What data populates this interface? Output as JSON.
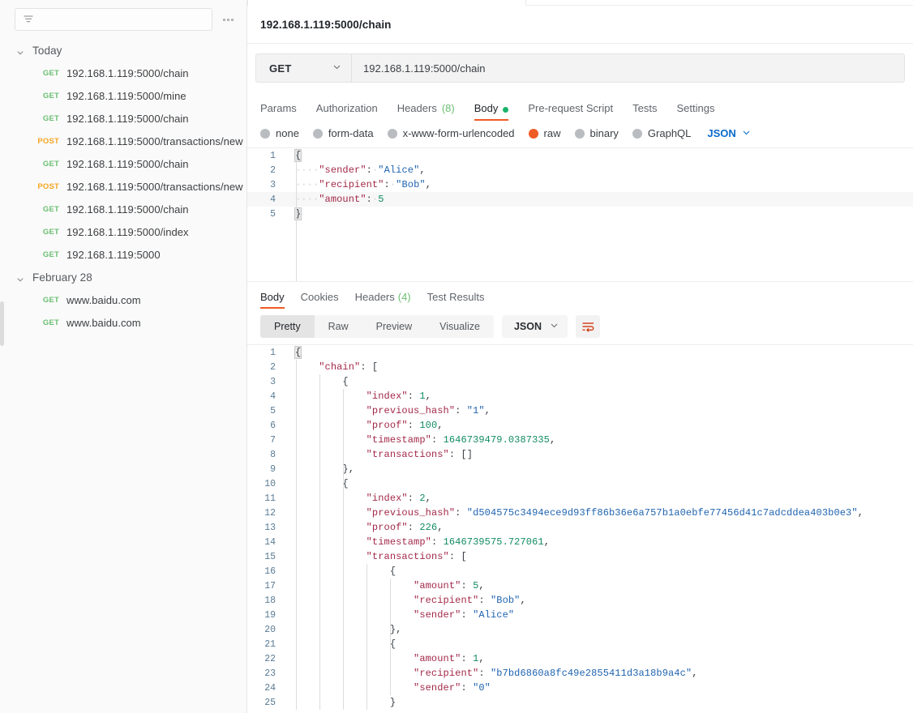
{
  "sidebar": {
    "filter_placeholder": "",
    "filter_icon": "filter-icon",
    "more_icon": "more-options-icon",
    "groups": [
      {
        "label": "Today",
        "items": [
          {
            "method": "GET",
            "url": "192.168.1.119:5000/chain"
          },
          {
            "method": "GET",
            "url": "192.168.1.119:5000/mine"
          },
          {
            "method": "GET",
            "url": "192.168.1.119:5000/chain"
          },
          {
            "method": "POST",
            "url": "192.168.1.119:5000/transactions/new"
          },
          {
            "method": "GET",
            "url": "192.168.1.119:5000/chain"
          },
          {
            "method": "POST",
            "url": "192.168.1.119:5000/transactions/new"
          },
          {
            "method": "GET",
            "url": "192.168.1.119:5000/chain"
          },
          {
            "method": "GET",
            "url": "192.168.1.119:5000/index"
          },
          {
            "method": "GET",
            "url": "192.168.1.119:5000"
          }
        ]
      },
      {
        "label": "February 28",
        "items": [
          {
            "method": "GET",
            "url": "www.baidu.com"
          },
          {
            "method": "GET",
            "url": "www.baidu.com"
          }
        ]
      }
    ]
  },
  "request": {
    "title": "192.168.1.119:5000/chain",
    "method": "GET",
    "url": "192.168.1.119:5000/chain",
    "tabs": [
      {
        "label": "Params",
        "count": "",
        "active": false,
        "dot": false
      },
      {
        "label": "Authorization",
        "count": "",
        "active": false,
        "dot": false
      },
      {
        "label": "Headers",
        "count": "(8)",
        "active": false,
        "dot": false
      },
      {
        "label": "Body",
        "count": "",
        "active": true,
        "dot": true
      },
      {
        "label": "Pre-request Script",
        "count": "",
        "active": false,
        "dot": false
      },
      {
        "label": "Tests",
        "count": "",
        "active": false,
        "dot": false
      },
      {
        "label": "Settings",
        "count": "",
        "active": false,
        "dot": false
      }
    ],
    "body_types": [
      {
        "label": "none",
        "selected": false
      },
      {
        "label": "form-data",
        "selected": false
      },
      {
        "label": "x-www-form-urlencoded",
        "selected": false
      },
      {
        "label": "raw",
        "selected": true
      },
      {
        "label": "binary",
        "selected": false
      },
      {
        "label": "GraphQL",
        "selected": false
      }
    ],
    "format": "JSON",
    "body_lines": [
      {
        "n": "1",
        "indent": 0,
        "highlight": false,
        "tokens": [
          {
            "t": "brace",
            "v": "{"
          }
        ]
      },
      {
        "n": "2",
        "indent": 1,
        "highlight": false,
        "tokens": [
          {
            "t": "dot",
            "v": "····"
          },
          {
            "t": "key",
            "v": "\"sender\""
          },
          {
            "t": "p",
            "v": ":"
          },
          {
            "t": "dot",
            "v": "·"
          },
          {
            "t": "str",
            "v": "\"Alice\""
          },
          {
            "t": "p",
            "v": ","
          }
        ]
      },
      {
        "n": "3",
        "indent": 1,
        "highlight": false,
        "tokens": [
          {
            "t": "dot",
            "v": "····"
          },
          {
            "t": "key",
            "v": "\"recipient\""
          },
          {
            "t": "p",
            "v": ":"
          },
          {
            "t": "dot",
            "v": "·"
          },
          {
            "t": "str",
            "v": "\"Bob\""
          },
          {
            "t": "p",
            "v": ","
          }
        ]
      },
      {
        "n": "4",
        "indent": 1,
        "highlight": true,
        "tokens": [
          {
            "t": "dot",
            "v": "····"
          },
          {
            "t": "key",
            "v": "\"amount\""
          },
          {
            "t": "p",
            "v": ":"
          },
          {
            "t": "dot",
            "v": "·"
          },
          {
            "t": "num",
            "v": "5"
          }
        ]
      },
      {
        "n": "5",
        "indent": 0,
        "highlight": false,
        "tokens": [
          {
            "t": "brace",
            "v": "}"
          }
        ]
      }
    ]
  },
  "response": {
    "tabs": [
      {
        "label": "Body",
        "count": "",
        "active": true
      },
      {
        "label": "Cookies",
        "count": "",
        "active": false
      },
      {
        "label": "Headers",
        "count": "(4)",
        "active": false
      },
      {
        "label": "Test Results",
        "count": "",
        "active": false
      }
    ],
    "view_modes": [
      {
        "label": "Pretty",
        "active": true
      },
      {
        "label": "Raw",
        "active": false
      },
      {
        "label": "Preview",
        "active": false
      },
      {
        "label": "Visualize",
        "active": false
      }
    ],
    "format": "JSON",
    "wrap_icon": "word-wrap-icon",
    "body_lines": [
      {
        "n": "1",
        "guides": 0,
        "tokens": [
          {
            "t": "brace",
            "v": "{"
          }
        ]
      },
      {
        "n": "2",
        "guides": 1,
        "tokens": [
          {
            "t": "p",
            "v": "    "
          },
          {
            "t": "key",
            "v": "\"chain\""
          },
          {
            "t": "p",
            "v": ": ["
          }
        ]
      },
      {
        "n": "3",
        "guides": 2,
        "tokens": [
          {
            "t": "p",
            "v": "        {"
          }
        ]
      },
      {
        "n": "4",
        "guides": 3,
        "tokens": [
          {
            "t": "p",
            "v": "            "
          },
          {
            "t": "key",
            "v": "\"index\""
          },
          {
            "t": "p",
            "v": ": "
          },
          {
            "t": "num",
            "v": "1"
          },
          {
            "t": "p",
            "v": ","
          }
        ]
      },
      {
        "n": "5",
        "guides": 3,
        "tokens": [
          {
            "t": "p",
            "v": "            "
          },
          {
            "t": "key",
            "v": "\"previous_hash\""
          },
          {
            "t": "p",
            "v": ": "
          },
          {
            "t": "str",
            "v": "\"1\""
          },
          {
            "t": "p",
            "v": ","
          }
        ]
      },
      {
        "n": "6",
        "guides": 3,
        "tokens": [
          {
            "t": "p",
            "v": "            "
          },
          {
            "t": "key",
            "v": "\"proof\""
          },
          {
            "t": "p",
            "v": ": "
          },
          {
            "t": "num",
            "v": "100"
          },
          {
            "t": "p",
            "v": ","
          }
        ]
      },
      {
        "n": "7",
        "guides": 3,
        "tokens": [
          {
            "t": "p",
            "v": "            "
          },
          {
            "t": "key",
            "v": "\"timestamp\""
          },
          {
            "t": "p",
            "v": ": "
          },
          {
            "t": "num",
            "v": "1646739479.0387335"
          },
          {
            "t": "p",
            "v": ","
          }
        ]
      },
      {
        "n": "8",
        "guides": 3,
        "tokens": [
          {
            "t": "p",
            "v": "            "
          },
          {
            "t": "key",
            "v": "\"transactions\""
          },
          {
            "t": "p",
            "v": ": []"
          }
        ]
      },
      {
        "n": "9",
        "guides": 2,
        "tokens": [
          {
            "t": "p",
            "v": "        },"
          }
        ]
      },
      {
        "n": "10",
        "guides": 2,
        "tokens": [
          {
            "t": "p",
            "v": "        {"
          }
        ]
      },
      {
        "n": "11",
        "guides": 3,
        "tokens": [
          {
            "t": "p",
            "v": "            "
          },
          {
            "t": "key",
            "v": "\"index\""
          },
          {
            "t": "p",
            "v": ": "
          },
          {
            "t": "num",
            "v": "2"
          },
          {
            "t": "p",
            "v": ","
          }
        ]
      },
      {
        "n": "12",
        "guides": 3,
        "tokens": [
          {
            "t": "p",
            "v": "            "
          },
          {
            "t": "key",
            "v": "\"previous_hash\""
          },
          {
            "t": "p",
            "v": ": "
          },
          {
            "t": "str",
            "v": "\"d504575c3494ece9d93ff86b36e6a757b1a0ebfe77456d41c7adcddea403b0e3\""
          },
          {
            "t": "p",
            "v": ","
          }
        ]
      },
      {
        "n": "13",
        "guides": 3,
        "tokens": [
          {
            "t": "p",
            "v": "            "
          },
          {
            "t": "key",
            "v": "\"proof\""
          },
          {
            "t": "p",
            "v": ": "
          },
          {
            "t": "num",
            "v": "226"
          },
          {
            "t": "p",
            "v": ","
          }
        ]
      },
      {
        "n": "14",
        "guides": 3,
        "tokens": [
          {
            "t": "p",
            "v": "            "
          },
          {
            "t": "key",
            "v": "\"timestamp\""
          },
          {
            "t": "p",
            "v": ": "
          },
          {
            "t": "num",
            "v": "1646739575.727061"
          },
          {
            "t": "p",
            "v": ","
          }
        ]
      },
      {
        "n": "15",
        "guides": 3,
        "tokens": [
          {
            "t": "p",
            "v": "            "
          },
          {
            "t": "key",
            "v": "\"transactions\""
          },
          {
            "t": "p",
            "v": ": ["
          }
        ]
      },
      {
        "n": "16",
        "guides": 4,
        "tokens": [
          {
            "t": "p",
            "v": "                {"
          }
        ]
      },
      {
        "n": "17",
        "guides": 5,
        "tokens": [
          {
            "t": "p",
            "v": "                    "
          },
          {
            "t": "key",
            "v": "\"amount\""
          },
          {
            "t": "p",
            "v": ": "
          },
          {
            "t": "num",
            "v": "5"
          },
          {
            "t": "p",
            "v": ","
          }
        ]
      },
      {
        "n": "18",
        "guides": 5,
        "tokens": [
          {
            "t": "p",
            "v": "                    "
          },
          {
            "t": "key",
            "v": "\"recipient\""
          },
          {
            "t": "p",
            "v": ": "
          },
          {
            "t": "str",
            "v": "\"Bob\""
          },
          {
            "t": "p",
            "v": ","
          }
        ]
      },
      {
        "n": "19",
        "guides": 5,
        "tokens": [
          {
            "t": "p",
            "v": "                    "
          },
          {
            "t": "key",
            "v": "\"sender\""
          },
          {
            "t": "p",
            "v": ": "
          },
          {
            "t": "str",
            "v": "\"Alice\""
          }
        ]
      },
      {
        "n": "20",
        "guides": 4,
        "tokens": [
          {
            "t": "p",
            "v": "                },"
          }
        ]
      },
      {
        "n": "21",
        "guides": 4,
        "tokens": [
          {
            "t": "p",
            "v": "                {"
          }
        ]
      },
      {
        "n": "22",
        "guides": 5,
        "tokens": [
          {
            "t": "p",
            "v": "                    "
          },
          {
            "t": "key",
            "v": "\"amount\""
          },
          {
            "t": "p",
            "v": ": "
          },
          {
            "t": "num",
            "v": "1"
          },
          {
            "t": "p",
            "v": ","
          }
        ]
      },
      {
        "n": "23",
        "guides": 5,
        "tokens": [
          {
            "t": "p",
            "v": "                    "
          },
          {
            "t": "key",
            "v": "\"recipient\""
          },
          {
            "t": "p",
            "v": ": "
          },
          {
            "t": "str",
            "v": "\"b7bd6860a8fc49e2855411d3a18b9a4c\""
          },
          {
            "t": "p",
            "v": ","
          }
        ]
      },
      {
        "n": "24",
        "guides": 5,
        "tokens": [
          {
            "t": "p",
            "v": "                    "
          },
          {
            "t": "key",
            "v": "\"sender\""
          },
          {
            "t": "p",
            "v": ": "
          },
          {
            "t": "str",
            "v": "\"0\""
          }
        ]
      },
      {
        "n": "25",
        "guides": 4,
        "tokens": [
          {
            "t": "p",
            "v": "                }"
          }
        ]
      }
    ]
  },
  "colors": {
    "accent": "#ef5b25",
    "get": "#6bbf73",
    "post": "#f5a623",
    "link": "#0b6bcb",
    "json_key": "#a3294a",
    "json_string": "#2064b0",
    "json_number": "#128c62"
  }
}
